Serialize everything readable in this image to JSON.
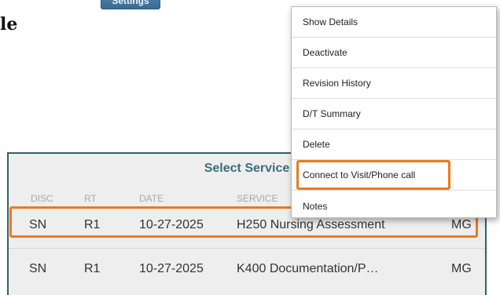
{
  "page": {
    "partial_title": "le"
  },
  "header": {
    "settings_label": "Settings"
  },
  "service_panel": {
    "title": "Select Service",
    "columns": [
      "DISC",
      "RT",
      "DATE",
      "SERVICE"
    ],
    "rows": [
      {
        "disc": "SN",
        "rt": "R1",
        "date": "10-27-2025",
        "service": "H250 Nursing Assessment",
        "user": "MG",
        "highlighted": true
      },
      {
        "disc": "SN",
        "rt": "R1",
        "date": "10-27-2025",
        "service": "K400 Documentation/P…",
        "user": "MG",
        "highlighted": false
      }
    ]
  },
  "context_menu": {
    "items": [
      {
        "label": "Show Details"
      },
      {
        "label": "Deactivate"
      },
      {
        "label": "Revision History"
      },
      {
        "label": "D/T Summary"
      },
      {
        "label": "Delete"
      },
      {
        "label": "Connect to Visit/Phone call",
        "highlighted": true
      },
      {
        "label": "Notes"
      }
    ]
  },
  "colors": {
    "highlight": "#e87b21",
    "panel_title": "#3b6f7a",
    "settings_button": "#4a7aa2"
  }
}
